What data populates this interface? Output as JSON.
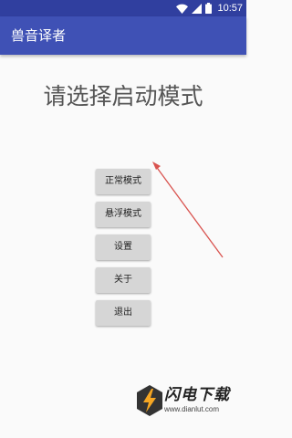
{
  "status_bar": {
    "time": "10:57",
    "icons": [
      "wifi-icon",
      "signal-icon",
      "battery-icon"
    ],
    "background": "#303f9f"
  },
  "app_bar": {
    "title": "兽音译者",
    "background": "#3f51b5"
  },
  "main": {
    "title": "请选择启动模式",
    "buttons": [
      {
        "label": "正常模式"
      },
      {
        "label": "悬浮模式"
      },
      {
        "label": "设置"
      },
      {
        "label": "关于"
      },
      {
        "label": "退出"
      }
    ]
  },
  "annotation": {
    "arrow_color": "#d9534f",
    "icon": "arrow-annotation-icon"
  },
  "watermark": {
    "name": "闪电下载",
    "url": "www.dianlut.com",
    "accent": "#f5a623"
  }
}
